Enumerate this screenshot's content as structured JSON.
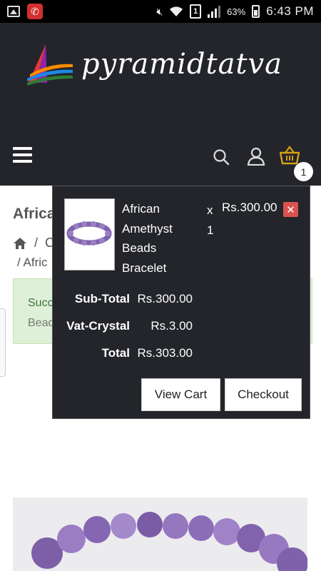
{
  "status_bar": {
    "battery_pct": "63%",
    "time": "6:43 PM",
    "sim_number": "1"
  },
  "header": {
    "logo_text": "pyramidtatva",
    "cart_count": "1"
  },
  "page": {
    "title": "Africa",
    "breadcrumb_row1_sep": "/",
    "breadcrumb_row1_text": "C",
    "breadcrumb_row2_sep": "/",
    "breadcrumb_row2_text": "Afric",
    "alert_line1": "Succ",
    "alert_line2": "Bead"
  },
  "cart": {
    "item": {
      "name_lines": [
        "African",
        "Amethyst",
        "Beads",
        "Bracelet"
      ],
      "x": "x",
      "quantity": "1",
      "price": "Rs.300.00",
      "remove_icon": "close-icon"
    },
    "totals": [
      {
        "label": "Sub-Total",
        "value": "Rs.300.00"
      },
      {
        "label": "Vat-Crystal",
        "value": "Rs.3.00"
      },
      {
        "label": "Total",
        "value": "Rs.303.00"
      }
    ],
    "view_cart_label": "View Cart",
    "checkout_label": "Checkout"
  },
  "colors": {
    "header_bg": "#23252a",
    "remove_red": "#d9534f",
    "alert_bg": "#dff0d8",
    "amethyst": "#8a6ab3"
  }
}
